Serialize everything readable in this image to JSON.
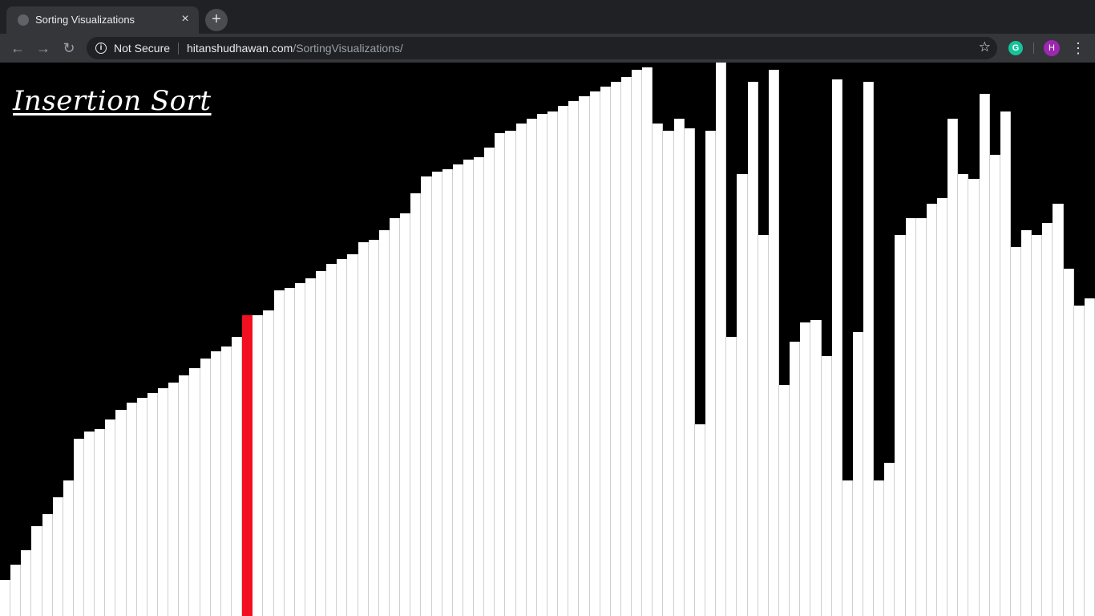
{
  "browser": {
    "tab_title": "Sorting Visualizations",
    "tab_close": "×",
    "new_tab": "+",
    "back_icon": "←",
    "forward_icon": "→",
    "reload_icon": "↻",
    "security_label": "Not Secure",
    "url_host": "hitanshudhawan.com",
    "url_path": "/SortingVisualizations/",
    "star_icon": "☆",
    "extension_letter": "G",
    "avatar_letter": "H",
    "menu_icon": "⋮"
  },
  "page": {
    "title": "Insertion Sort",
    "background_color": "#000000",
    "bar_color": "#ffffff",
    "active_bar_color": "#f20f1f",
    "active_index": 23,
    "values": [
      15,
      21,
      27,
      37,
      42,
      49,
      56,
      73,
      76,
      77,
      81,
      85,
      88,
      90,
      92,
      94,
      96,
      99,
      102,
      106,
      109,
      111,
      115,
      124,
      124,
      126,
      134,
      135,
      137,
      139,
      142,
      145,
      147,
      149,
      154,
      155,
      159,
      164,
      166,
      174,
      181,
      183,
      184,
      186,
      188,
      189,
      193,
      199,
      200,
      203,
      205,
      207,
      208,
      210,
      212,
      214,
      216,
      218,
      220,
      222,
      225,
      226,
      203,
      200,
      205,
      201,
      79,
      200,
      228,
      115,
      182,
      220,
      157,
      225,
      95,
      113,
      121,
      122,
      107,
      221,
      56,
      117,
      220,
      56,
      63,
      157,
      164,
      164,
      170,
      172,
      205,
      182,
      180,
      215,
      190,
      208,
      152,
      159,
      157,
      162,
      170,
      143,
      128,
      131
    ]
  }
}
